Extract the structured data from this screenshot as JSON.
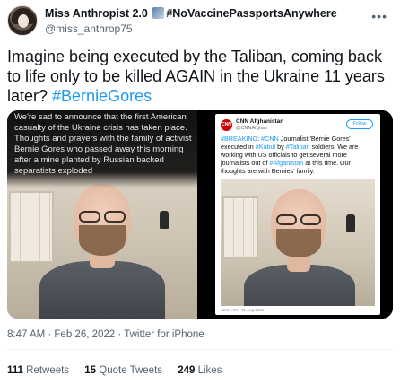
{
  "author": {
    "display_name": "Miss Anthropist 2.0",
    "display_name_suffix": "#NoVaccinePassportsAnywhere",
    "emoji_icon": "cityscape-emoji-icon",
    "handle": "@miss_anthrop75",
    "more_icon": "more-horizontal-icon"
  },
  "tweet": {
    "text": "Imagine being executed by the Taliban, coming back to life only to be killed AGAIN in the Ukraine 11 years later? ",
    "hashtag": "#BernieGores"
  },
  "media": {
    "left_caption": "We're sad to announce that the first American casualty of the Ukraine crisis has taken place. Thoughts and prayers with the family of activist Bernie Gores who passed away this morning after a mine planted by Russian backed separatists exploded",
    "embedded_tweet": {
      "logo_text": "CNN",
      "name": "CNN Afghanistan",
      "handle": "@CNNAfghan",
      "follow_label": "Follow",
      "text_parts": [
        {
          "t": "#BREAKING",
          "tag": true
        },
        {
          "t": ": ",
          "tag": false
        },
        {
          "t": "#CNN",
          "tag": true
        },
        {
          "t": " Journalist 'Bernie Gores' executed in ",
          "tag": false
        },
        {
          "t": "#Kabul",
          "tag": true
        },
        {
          "t": " by ",
          "tag": false
        },
        {
          "t": "#Taliban",
          "tag": true
        },
        {
          "t": " soldiers. We are working with US officials to get several more journalists out of ",
          "tag": false
        },
        {
          "t": "#Afganistan",
          "tag": true
        },
        {
          "t": " at this time. Our thoughts are with Bernies' family.",
          "tag": false
        }
      ],
      "footer": "12:04 AM · 16 Aug 2021"
    }
  },
  "meta": {
    "timestamp": "8:47 AM · Feb 26, 2022 · Twitter for iPhone"
  },
  "stats": {
    "retweets_count": "111",
    "retweets_label": "Retweets",
    "quotes_count": "15",
    "quotes_label": "Quote Tweets",
    "likes_count": "249",
    "likes_label": "Likes"
  },
  "colors": {
    "link": "#1d9bf0",
    "secondary_text": "#536471",
    "primary_text": "#0f1419",
    "cnn_red": "#cc0000"
  }
}
